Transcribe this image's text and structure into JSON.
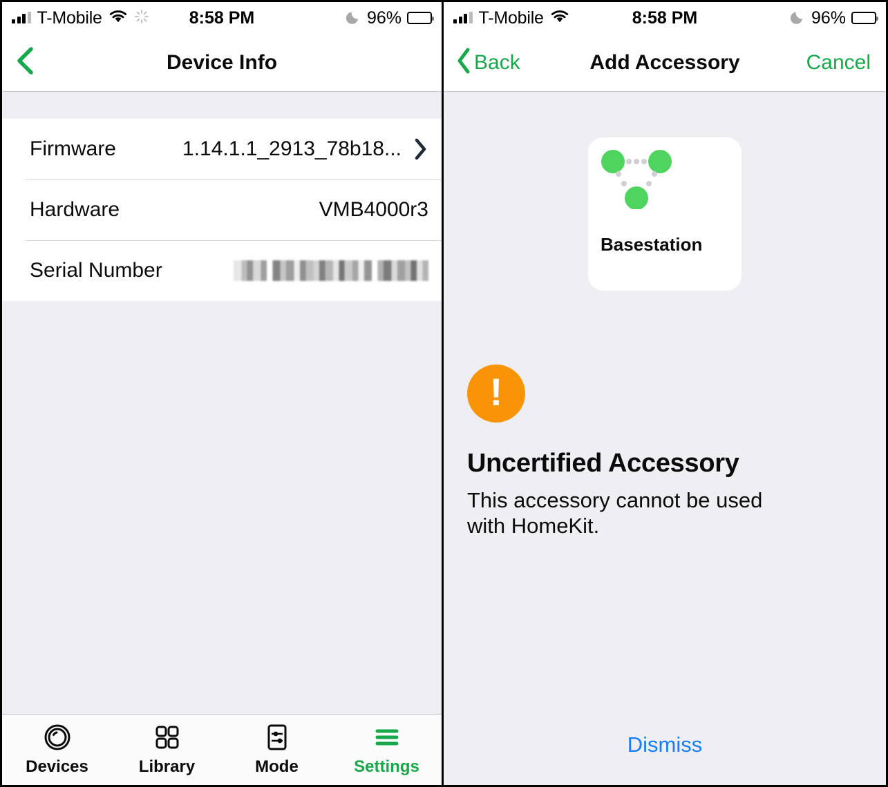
{
  "left_panel": {
    "status_bar": {
      "signal_icon": "cellular-signal-icon",
      "carrier": "T-Mobile",
      "wifi_icon": "wifi-icon",
      "activity_icon": "activity-spinner-icon",
      "time": "8:58 PM",
      "dnd_icon": "moon-do-not-disturb-icon",
      "battery_percent": "96%",
      "battery_icon": "battery-full-icon"
    },
    "nav": {
      "back_icon": "chevron-left-icon",
      "title": "Device Info"
    },
    "list": {
      "rows": [
        {
          "label": "Firmware",
          "value": "1.14.1.1_2913_78b18...",
          "has_chevron": true,
          "redacted": false
        },
        {
          "label": "Hardware",
          "value": "VMB4000r3",
          "has_chevron": false,
          "redacted": false
        },
        {
          "label": "Serial Number",
          "value": "",
          "has_chevron": false,
          "redacted": true
        }
      ]
    },
    "tabbar": {
      "tabs": [
        {
          "label": "Devices",
          "icon": "camera-lens-icon",
          "active": false
        },
        {
          "label": "Library",
          "icon": "grid-squares-icon",
          "active": false
        },
        {
          "label": "Mode",
          "icon": "sliders-square-icon",
          "active": false
        },
        {
          "label": "Settings",
          "icon": "hamburger-menu-icon",
          "active": true
        }
      ]
    }
  },
  "right_panel": {
    "status_bar": {
      "signal_icon": "cellular-signal-icon",
      "carrier": "T-Mobile",
      "wifi_icon": "wifi-icon",
      "time": "8:58 PM",
      "dnd_icon": "moon-do-not-disturb-icon",
      "battery_percent": "96%",
      "battery_icon": "battery-full-icon"
    },
    "nav": {
      "back_icon": "chevron-left-icon",
      "back_label": "Back",
      "title": "Add Accessory",
      "cancel_label": "Cancel"
    },
    "accessory": {
      "icon": "basestation-nodes-icon",
      "name": "Basestation"
    },
    "alert": {
      "icon": "warning-exclamation-icon",
      "title": "Uncertified Accessory",
      "message": "This accessory cannot be used with HomeKit."
    },
    "dismiss_label": "Dismiss"
  },
  "colors": {
    "accent_green": "#17A84B",
    "node_green": "#4ED45F",
    "warning_orange": "#F89406",
    "link_blue": "#157EFB",
    "background": "#EFEEF3",
    "chevron_navy": "#1F2A37"
  }
}
